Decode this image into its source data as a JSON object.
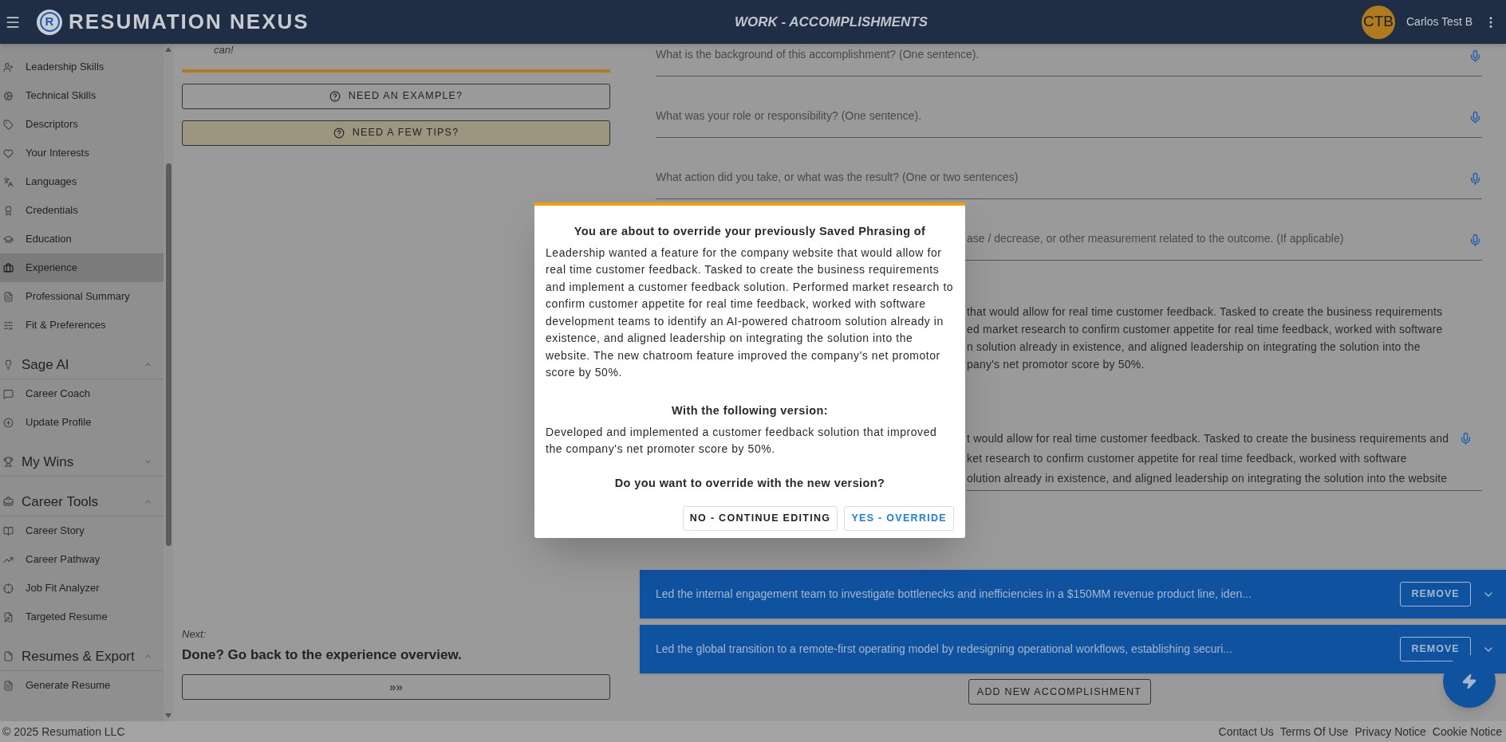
{
  "header": {
    "logo_letter": "R",
    "title": "RESUMATION NEXUS",
    "page_title": "WORK - ACCOMPLISHMENTS",
    "avatar": "CTB",
    "user": "Carlos Test B"
  },
  "sidebar": {
    "groups": [
      {
        "items": [
          {
            "label": "Leadership Skills",
            "selected": false
          },
          {
            "label": "Technical Skills",
            "selected": false
          },
          {
            "label": "Descriptors",
            "selected": false
          },
          {
            "label": "Your Interests",
            "selected": false
          },
          {
            "label": "Languages",
            "selected": false
          },
          {
            "label": "Credentials",
            "selected": false
          },
          {
            "label": "Education",
            "selected": false
          },
          {
            "label": "Experience",
            "selected": true
          },
          {
            "label": "Professional Summary",
            "selected": false
          },
          {
            "label": "Fit & Preferences",
            "selected": false
          }
        ]
      },
      {
        "title": "Sage AI",
        "expanded": true,
        "items": [
          {
            "label": "Career Coach",
            "selected": false
          },
          {
            "label": "Update Profile",
            "selected": false
          }
        ]
      },
      {
        "title": "My Wins",
        "expanded": false
      },
      {
        "title": "Career Tools",
        "expanded": true,
        "items": [
          {
            "label": "Career Story",
            "selected": false
          },
          {
            "label": "Career Pathway",
            "selected": false
          },
          {
            "label": "Job Fit Analyzer",
            "selected": false
          },
          {
            "label": "Targeted Resume",
            "selected": false
          }
        ]
      },
      {
        "title": "Resumes & Export",
        "expanded": true,
        "items": [
          {
            "label": "Generate Resume",
            "selected": false
          }
        ]
      }
    ]
  },
  "guide": {
    "intro_tail": "can!",
    "buttons": [
      {
        "label": "NEED AN EXAMPLE?",
        "highlighted": false
      },
      {
        "label": "NEED A FEW TIPS?",
        "highlighted": true
      }
    ],
    "next_label": "Next:",
    "next_title": "Done? Go back to the experience overview.",
    "next_button": "»»"
  },
  "fields": [
    {
      "kind": "open",
      "placeholder": "What is the background of this accomplishment? (One sentence)."
    },
    {
      "kind": "open",
      "placeholder": "What was your role or responsibility? (One sentence)."
    },
    {
      "kind": "open",
      "placeholder": "What action did you take, or what was the result? (One or two sentences)"
    },
    {
      "kind": "behind_dialog",
      "placeholder": "ase / decrease, or other measurement related to the outcome. (If applicable)"
    }
  ],
  "saved_phrasing": {
    "lines": [
      "that would allow for real time customer feedback. Tasked to create the business requirements",
      "ed market research to confirm customer appetite for real time feedback, worked with software",
      "n solution already in existence, and aligned leadership on integrating the solution into the",
      "pany's net promotor score by 50%."
    ]
  },
  "edit_field": {
    "lines": [
      "t would allow for real time customer feedback. Tasked to create the business requirements and",
      "ket research to confirm customer appetite for real time feedback, worked with software",
      "olution already in existence, and aligned leadership on integrating the solution into the website"
    ]
  },
  "accomplishments": [
    {
      "text": "Led the internal engagement team to investigate bottlenecks and inefficiencies in a $150MM revenue product line, iden...",
      "button": "REMOVE",
      "expanded": false
    },
    {
      "text": "Led the global transition to a remote-first operating model by redesigning operational workflows, establishing securi...",
      "button": "REMOVE",
      "expanded": false
    }
  ],
  "add_button": "ADD NEW ACCOMPLISHMENT",
  "footer": {
    "copyright": "© 2025 Resumation LLC",
    "links": [
      "Contact Us",
      "Terms Of Use",
      "Privacy Notice",
      "Cookie Notice"
    ]
  },
  "dialog": {
    "title": "You are about to override your previously Saved Phrasing of",
    "original": "Leadership wanted a feature for the company website that would allow for real time customer feedback. Tasked to create the business requirements and implement a customer feedback solution. Performed market research to confirm customer appetite for real time feedback, worked with software development teams to identify an AI-powered chatroom solution already in existence, and aligned leadership on integrating the solution into the website. The new chatroom feature improved the company's net promotor score by 50%.",
    "with_label": "With the following version:",
    "new_text": "Developed and implemented a customer feedback solution that improved the company's net promoter score by 50%.",
    "question": "Do you want to override with the new version?",
    "buttons": [
      {
        "label": "NO - CONTINUE EDITING",
        "primary": false
      },
      {
        "label": "YES - OVERRIDE",
        "primary": true
      }
    ]
  }
}
